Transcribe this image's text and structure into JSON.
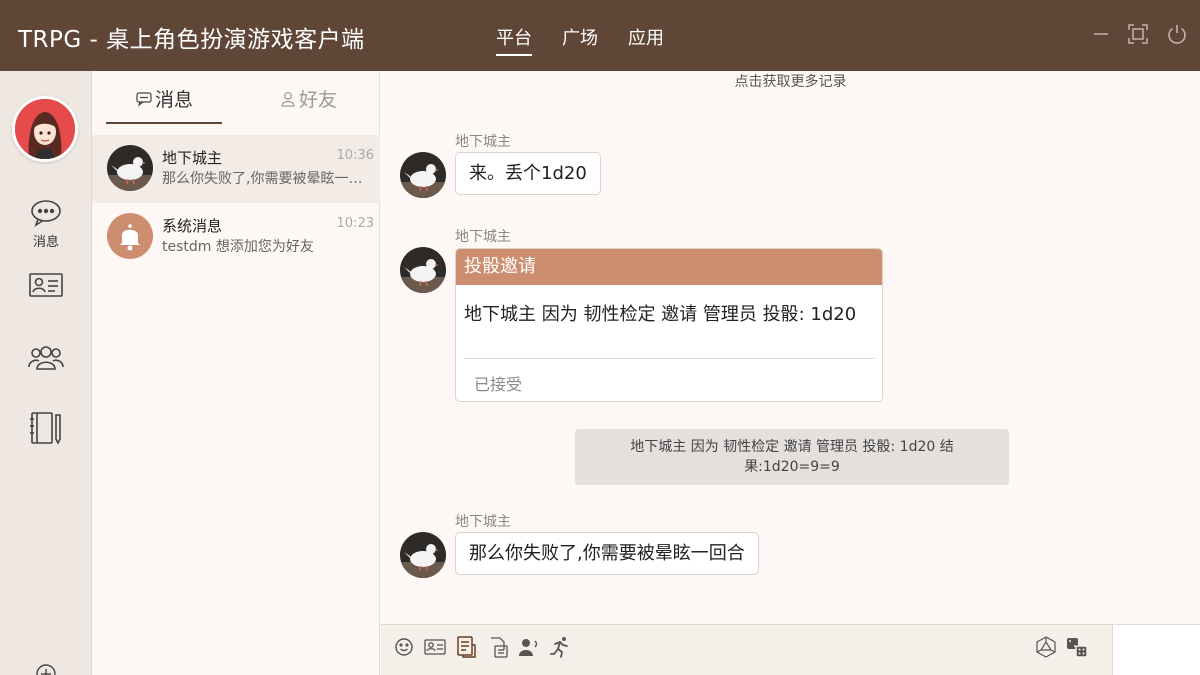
{
  "window": {
    "title": "TRPG - 桌上角色扮演游戏客户端",
    "nav": [
      {
        "label": "平台",
        "active": true
      },
      {
        "label": "广场",
        "active": false
      },
      {
        "label": "应用",
        "active": false
      }
    ],
    "controls": [
      "minimize-icon",
      "maximize-icon",
      "power-icon"
    ]
  },
  "sidebar": {
    "items": [
      {
        "icon": "chat-bubble-icon",
        "label": "消息"
      },
      {
        "icon": "id-card-icon",
        "label": ""
      },
      {
        "icon": "group-icon",
        "label": ""
      },
      {
        "icon": "notebook-icon",
        "label": ""
      },
      {
        "icon": "add-icon",
        "label": ""
      }
    ]
  },
  "conversation_list": {
    "tabs": [
      {
        "label": "消息",
        "icon": "chat-icon",
        "active": true
      },
      {
        "label": "好友",
        "icon": "person-icon",
        "active": false
      }
    ],
    "items": [
      {
        "name": "地下城主",
        "time": "10:36",
        "preview": "那么你失败了,你需要被晕眩一回合",
        "avatar": "pigeon-avatar",
        "selected": true
      },
      {
        "name": "系统消息",
        "time": "10:23",
        "preview": "testdm 想添加您为好友",
        "avatar": "bell-avatar",
        "selected": false
      }
    ]
  },
  "chat": {
    "more_records": "点击获取更多记录",
    "messages": [
      {
        "sender": "地下城主",
        "text": "来。丢个1d20"
      },
      {
        "sender": "地下城主",
        "card": {
          "title": "投骰邀请",
          "body": "地下城主 因为 韧性检定 邀请 管理员 投骰: 1d20",
          "status": "已接受"
        }
      },
      {
        "system": "地下城主 因为 韧性检定 邀请 管理员 投骰: 1d20 结果:1d20=9=9"
      },
      {
        "sender": "地下城主",
        "text": "那么你失败了,你需要被晕眩一回合"
      }
    ]
  },
  "toolbar": {
    "left_tools": [
      "emoji-icon",
      "id-card-icon",
      "document-icon",
      "file-icon",
      "user-voice-icon",
      "runner-icon"
    ],
    "right_tools": [
      "d20-dice-icon",
      "dice-icon"
    ]
  },
  "colors": {
    "titlebar": "#5f4637",
    "accent": "#cd8e6f",
    "background": "#fdf8f5",
    "sidebar": "#efe7e1"
  }
}
